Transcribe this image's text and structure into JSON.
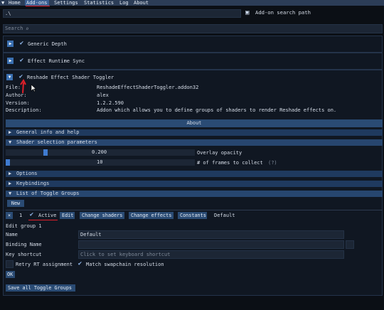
{
  "menu": {
    "items": [
      "Home",
      "Add-ons",
      "Settings",
      "Statistics",
      "Log",
      "About"
    ],
    "active_index": 1
  },
  "path_row": {
    "path_value": ".\\",
    "addon_search_path_label": "Add-on search path"
  },
  "search": {
    "label": "Search",
    "icon": "search-icon"
  },
  "addons": [
    {
      "name": "Generic Depth",
      "expanded": false,
      "enabled": true
    },
    {
      "name": "Effect Runtime Sync",
      "expanded": false,
      "enabled": true
    },
    {
      "name": "Reshade Effect Shader Toggler",
      "expanded": true,
      "enabled": true
    }
  ],
  "details": {
    "file_label": "File:",
    "file_value": "ReshadeEffectShaderToggler.addon32",
    "author_label": "Author:",
    "author_value": "alex",
    "version_label": "Version:",
    "version_value": "1.2.2.590",
    "description_label": "Description:",
    "description_value": "Addon which allows you to define groups of shaders to render Reshade effects on."
  },
  "about_button": "About",
  "sections": {
    "general_info": "General info and help",
    "shader_selection": "Shader selection parameters",
    "options": "Options",
    "keybindings": "Keybindings",
    "list_toggle_groups": "List of Toggle Groups"
  },
  "sliders": [
    {
      "value_text": "0.200",
      "label": "Overlay opacity",
      "fraction": 0.2
    },
    {
      "value_text": "10",
      "label": "# of frames to collect",
      "help": "(?)",
      "fraction": 0.0
    }
  ],
  "new_button": "New",
  "group_row": {
    "close_glyph": "×",
    "index": "1",
    "active_label": "Active",
    "edit_button": "Edit",
    "change_shaders": "Change shaders",
    "change_effects": "Change effects",
    "constants": "Constants",
    "group_name": "Default"
  },
  "edit_group": {
    "title": "Edit group 1",
    "name_label": "Name",
    "name_value": "Default",
    "binding_label": "Binding Name",
    "binding_value": "",
    "key_label": "Key shortcut",
    "key_placeholder": "Click to set keyboard shortcut",
    "retry_label": "Retry RT assignment",
    "match_label": "Match swapchain resolution",
    "ok_button": "OK"
  },
  "save_all_button": "Save all Toggle Groups",
  "colors": {
    "accent": "#3a6fb0",
    "header": "#1f3a5f",
    "annotation_red": "#e0202a"
  }
}
